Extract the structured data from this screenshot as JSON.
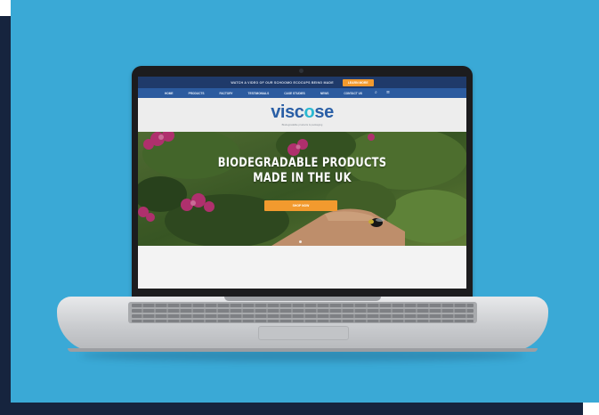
{
  "promo": {
    "text": "WATCH A VIDEO OF OUR SCHOOMO ECOCUPS BEING MADE",
    "button": "LEARN MORE"
  },
  "nav": {
    "items": [
      "HOME",
      "PRODUCTS",
      "FACTORY",
      "TESTIMONIALS",
      "CASE STUDIES",
      "NEWS",
      "CONTACT US"
    ],
    "search_icon": "search-icon",
    "menu_icon": "menu-icon"
  },
  "logo": {
    "part1": "visc",
    "accent": "o",
    "part2": "se",
    "tagline": "Biodegradable products & packaging",
    "color_main": "#2a5fa6",
    "color_accent": "#2ab9d2"
  },
  "hero": {
    "title_line1": "BIODEGRADABLE PRODUCTS",
    "title_line2": "MADE IN THE UK",
    "button": "SHOP NOW"
  },
  "colors": {
    "background": "#3aa9d6",
    "navy": "#16243e",
    "orange": "#f29a2e",
    "nav_blue": "#2c5b9f"
  }
}
